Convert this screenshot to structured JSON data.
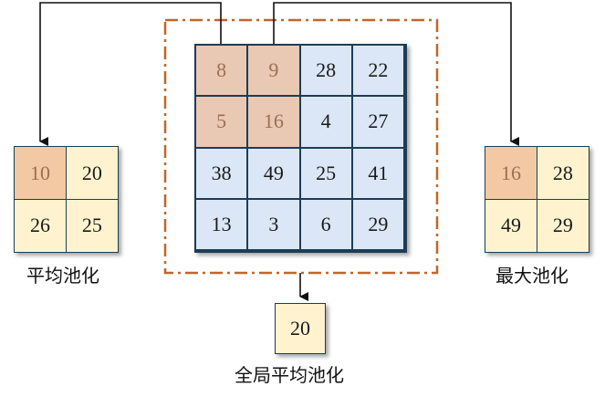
{
  "input_grid": [
    [
      8,
      9,
      28,
      22
    ],
    [
      5,
      16,
      4,
      27
    ],
    [
      38,
      49,
      25,
      41
    ],
    [
      13,
      3,
      6,
      29
    ]
  ],
  "avg_pool": {
    "values": [
      [
        10,
        20
      ],
      [
        26,
        25
      ]
    ],
    "label": "平均池化"
  },
  "max_pool": {
    "values": [
      [
        16,
        28
      ],
      [
        49,
        29
      ]
    ],
    "label": "最大池化"
  },
  "global_avg_pool": {
    "value": 20,
    "label": "全局平均池化"
  },
  "colors": {
    "grid_blue": "#dbe7f6",
    "highlight": "#e9c8b4",
    "output_yellow": "#fff3cf",
    "output_orange": "#f3c9a3",
    "dashed_border": "#c0662a"
  }
}
